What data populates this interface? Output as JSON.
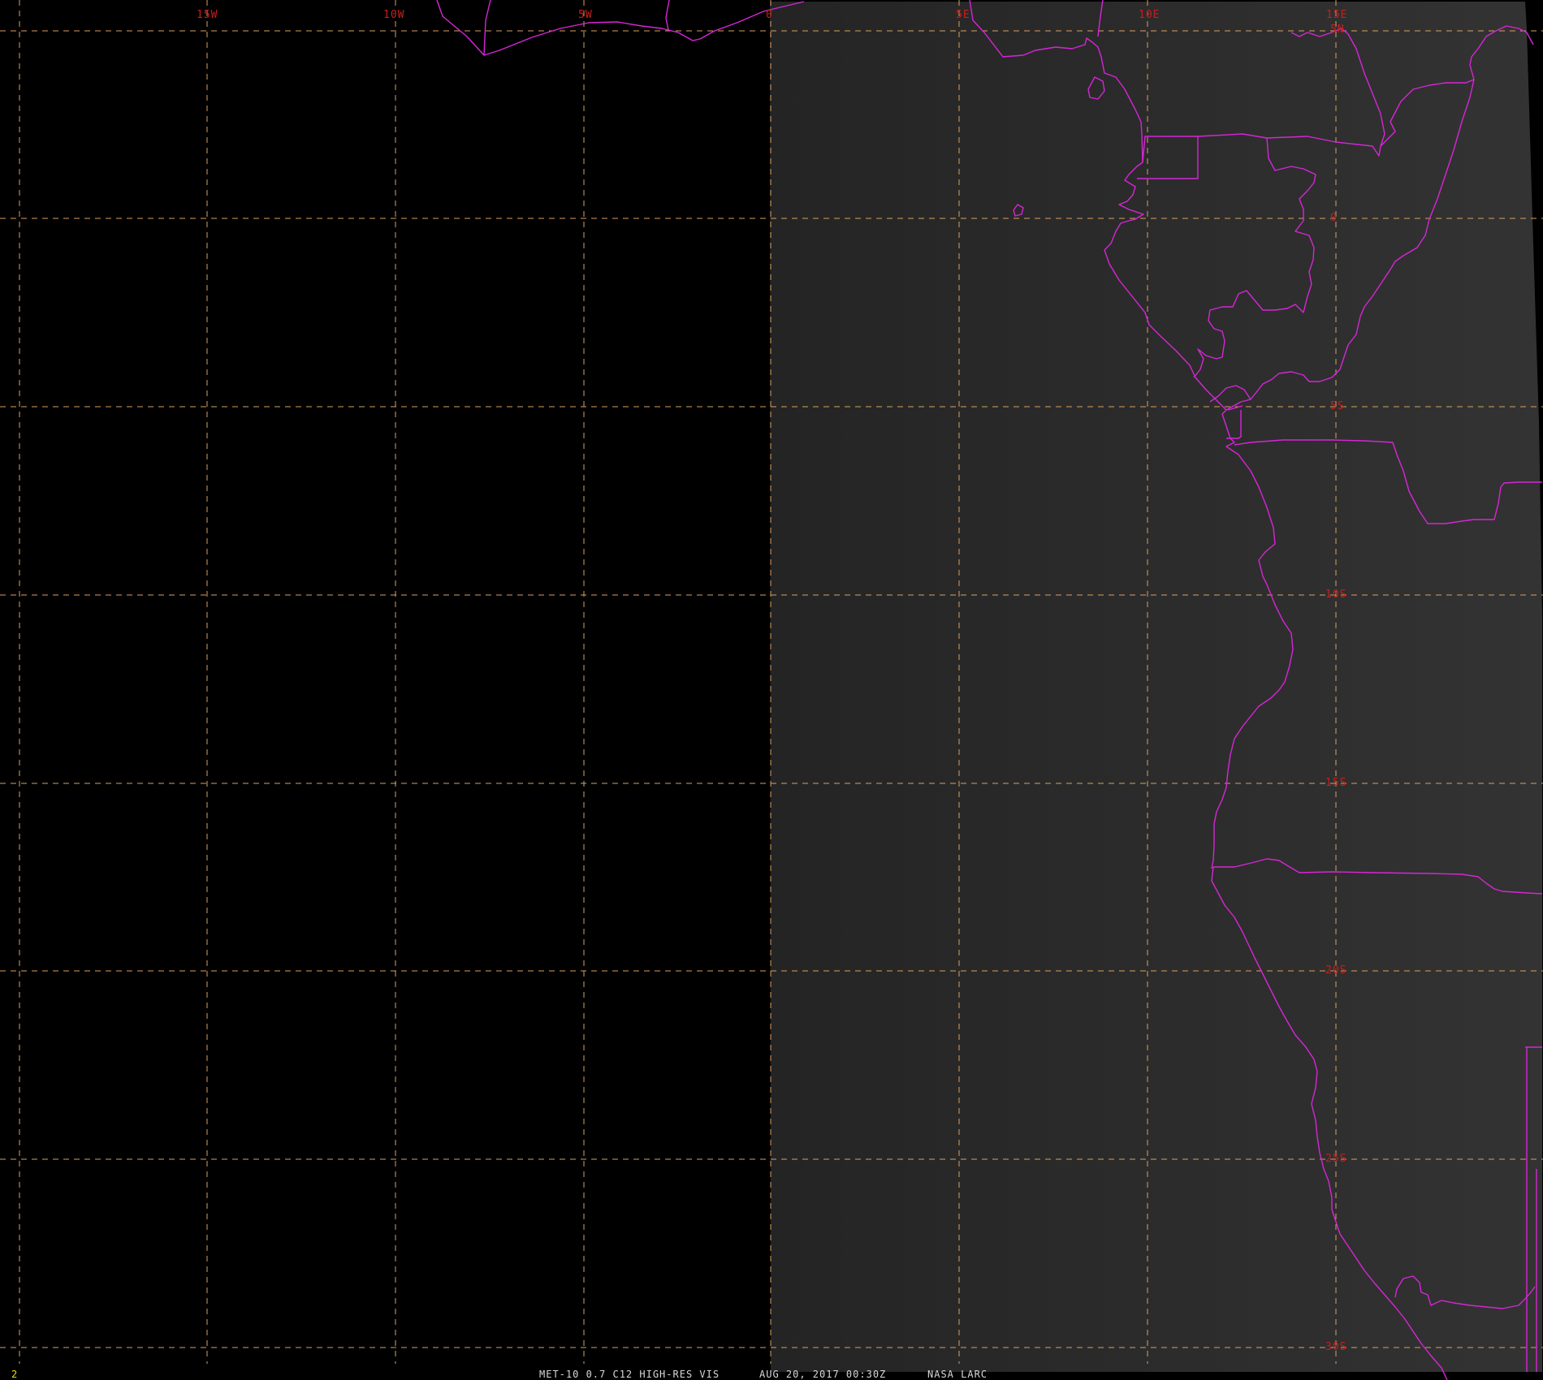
{
  "map": {
    "colors": {
      "background": "#000000",
      "imagery": "#2a2a2a",
      "gridlines": "#d8a060",
      "grid_labels": "#c81e1e",
      "boundaries": "#d626d6",
      "status_text": "#d8d8d8",
      "frame_number": "#e0e000"
    },
    "longitude_labels": [
      "15W",
      "10W",
      "5W",
      "0",
      "5E",
      "10E",
      "15E"
    ],
    "latitude_labels": [
      "5N",
      "0",
      "5S",
      "10S",
      "15S",
      "20S",
      "25S",
      "30S"
    ]
  },
  "status_bar": {
    "frame_number": "2",
    "product": "MET-10 0.7 C12 HIGH-RES VIS",
    "datetime": "AUG 20, 2017 00:30Z",
    "source": "NASA LARC"
  }
}
